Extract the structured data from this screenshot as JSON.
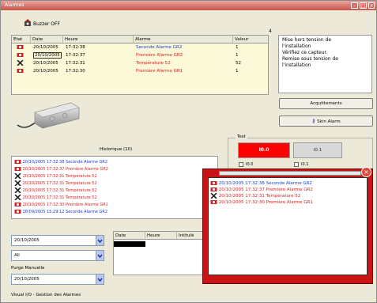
{
  "window": {
    "title": "Alarmes"
  },
  "toolbar": {
    "buzzer_label": "Buzzer OFF"
  },
  "alarm_count": "4",
  "alarm_table": {
    "headers": {
      "etat": "Etat",
      "date": "Date",
      "heure": "Heure",
      "alarme": "Alarme",
      "valeur": "Valeur"
    },
    "rows": [
      {
        "date": "20/10/2005",
        "heure": "17:32:38",
        "alarme": "Seconde Alarme GR2",
        "valeur": "1",
        "color": "blue",
        "icon": "bell-icon"
      },
      {
        "date": "20/10/2005",
        "heure": "17:32:37",
        "alarme": "Première Alarme GR2",
        "valeur": "1",
        "color": "red",
        "icon": "bell-icon"
      },
      {
        "date": "20/10/2005",
        "heure": "17:32:31",
        "alarme": "Température 52",
        "valeur": "52",
        "color": "red",
        "icon": "cross-icon"
      },
      {
        "date": "20/10/2005",
        "heure": "17:32:30",
        "alarme": "Première Alarme GR1",
        "valeur": "1",
        "color": "red",
        "icon": "bell-icon"
      }
    ]
  },
  "message": {
    "lines": [
      "Mise hors tension de",
      "l'installation",
      "Vérifiez ce capteur.",
      "Remise sous tension de",
      "l'installation"
    ]
  },
  "buttons": {
    "acquittements": "Acquittements",
    "skin_alarm": "Skin Alarm"
  },
  "test": {
    "label": "Test",
    "io0": "I0.0",
    "io1": "I0.1",
    "c1": "I0.0",
    "c2": "I0.1"
  },
  "historique": {
    "title": "Historique (10)",
    "rows": [
      {
        "text": "20/10/2005 17:32:38 Seconde Alarme GR2",
        "color": "blue",
        "icon": "bell-icon"
      },
      {
        "text": "20/10/2005 17:32:37 Première Alarme GR2",
        "color": "red",
        "icon": "bell-icon"
      },
      {
        "text": "20/10/2005 17:32:31 Température 52",
        "color": "red",
        "icon": "cross-icon"
      },
      {
        "text": "20/10/2005 17:32:31 Température 52",
        "color": "red",
        "icon": "cross-icon"
      },
      {
        "text": "20/10/2005 17:32:31 Température 52",
        "color": "red",
        "icon": "cross-icon"
      },
      {
        "text": "20/10/2005 17:32:31 Température 52",
        "color": "red",
        "icon": "cross-icon"
      },
      {
        "text": "20/10/2005 17:32:30 Première Alarme GR1",
        "color": "red",
        "icon": "bell-icon"
      },
      {
        "text": "28/09/2005 15:29:12 Seconde Alarme GR2",
        "color": "blue",
        "icon": "bell-icon"
      }
    ]
  },
  "filters": {
    "date": "20/10/2005",
    "type": "All",
    "purge_label": "Purge Manuelle",
    "purge_date": "20/10/2005"
  },
  "grid2": {
    "headers": [
      "Date",
      "Heure",
      "Intitulé"
    ]
  },
  "popup": {
    "rows": [
      {
        "text": "20/10/2005 17:32:38 Seconde Alarme GR2",
        "color": "blue",
        "icon": "bell-icon"
      },
      {
        "text": "20/10/2005 17:32:37 Première Alarme GR2",
        "color": "red",
        "icon": "bell-icon"
      },
      {
        "text": "20/10/2005 17:32:31 Température 52",
        "color": "red",
        "icon": "cross-icon"
      },
      {
        "text": "20/10/2005 17:32:30 Première Alarme GR1",
        "color": "red",
        "icon": "bell-icon"
      }
    ]
  },
  "status": {
    "text": "Visual I/O - Gestion des Alarmes"
  },
  "colors": {
    "accent_red": "#c81414",
    "alarm_blue": "#1a3fd2",
    "alarm_red": "#e02020",
    "table_bg": "#fbf9d8"
  }
}
